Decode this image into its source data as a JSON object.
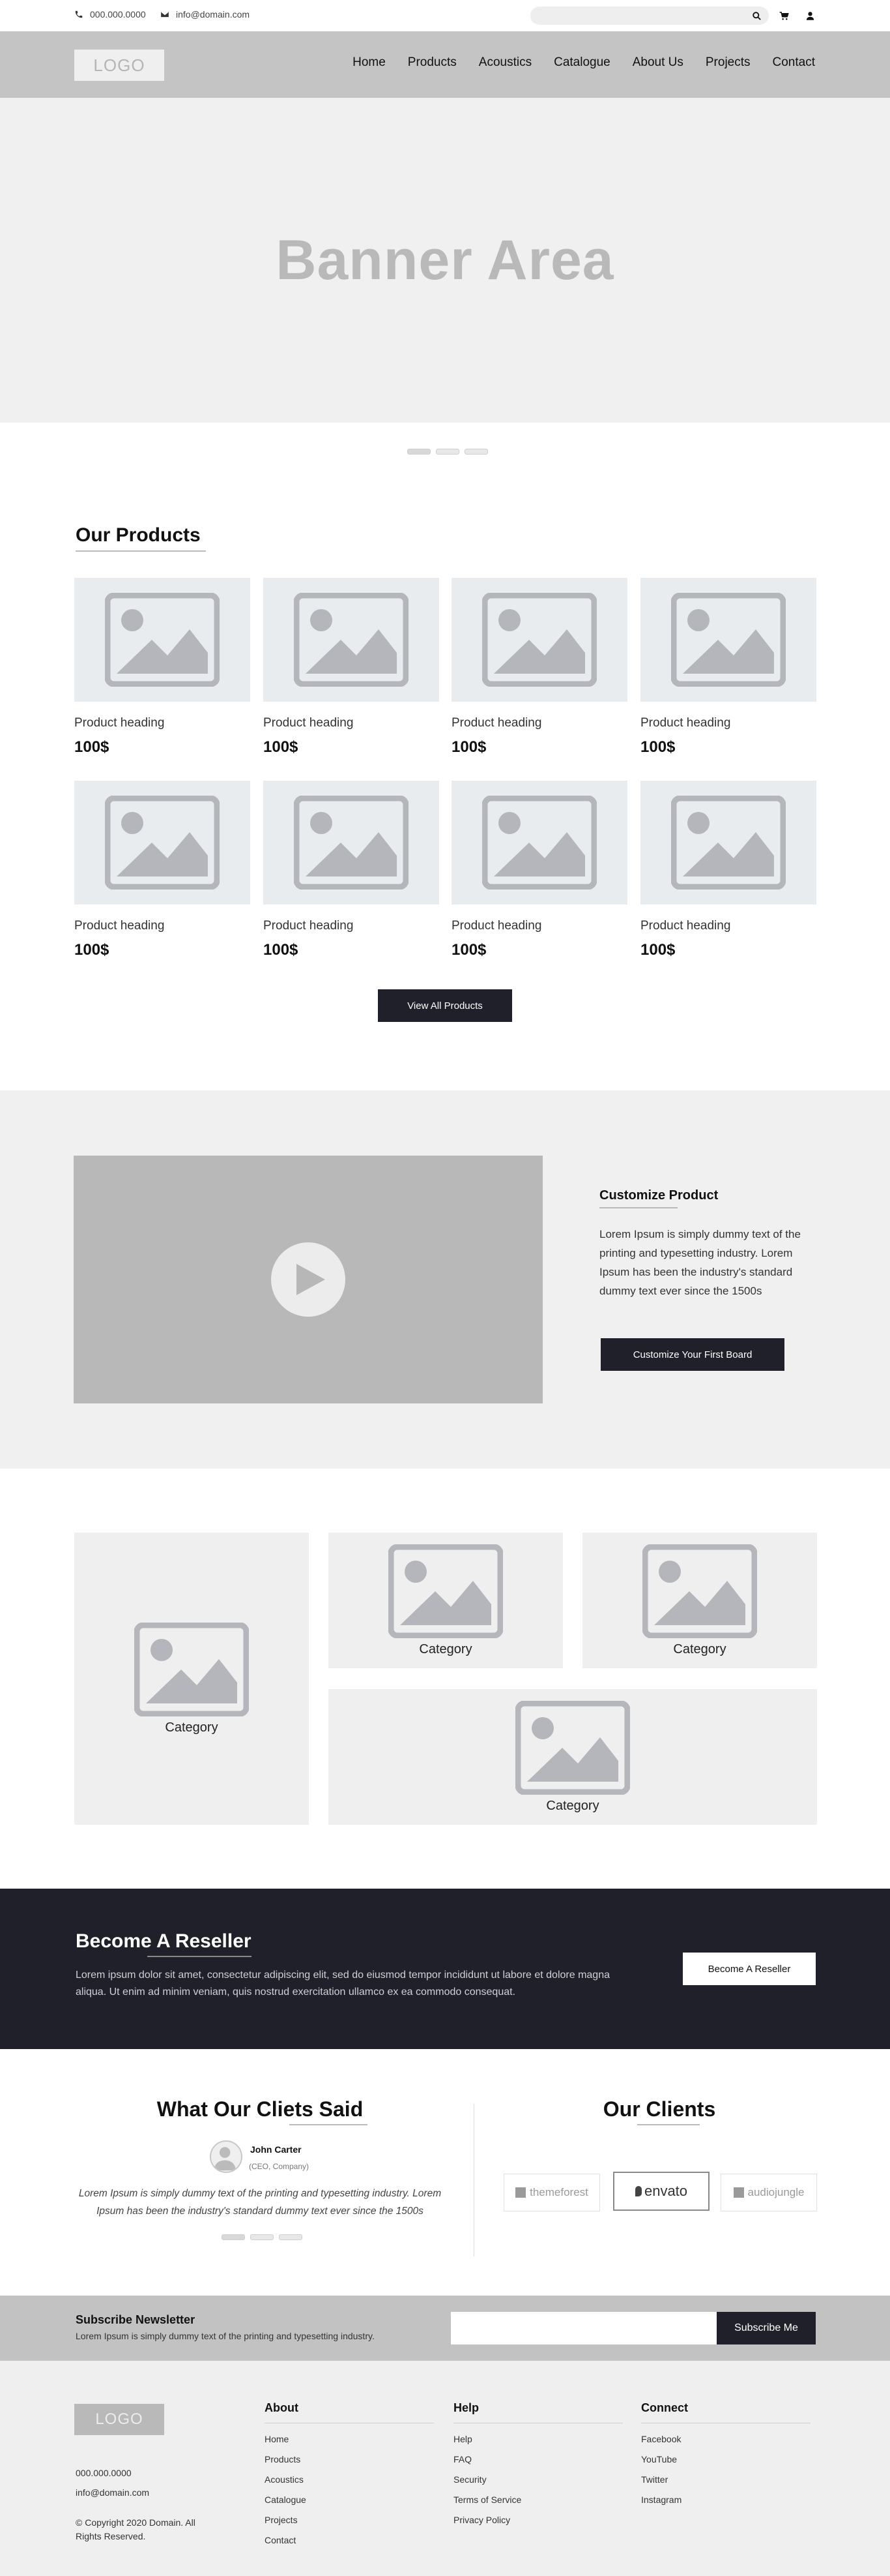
{
  "topbar": {
    "phone": "000.000.0000",
    "email": "info@domain.com",
    "search_placeholder": "",
    "icons": [
      "phone-icon",
      "mail-icon",
      "search-icon",
      "cart-icon",
      "user-icon"
    ]
  },
  "header": {
    "logo": "LOGO",
    "nav": [
      "Home",
      "Products",
      "Acoustics",
      "Catalogue",
      "About Us",
      "Projects",
      "Contact"
    ]
  },
  "banner": {
    "title": "Banner Area",
    "slides": 3,
    "active_slide": 1
  },
  "products": {
    "title": "Our Products",
    "items": [
      {
        "name": "Product  heading",
        "price": "100$"
      },
      {
        "name": "Product  heading",
        "price": "100$"
      },
      {
        "name": "Product  heading",
        "price": "100$"
      },
      {
        "name": "Product  heading",
        "price": "100$"
      },
      {
        "name": "Product  heading",
        "price": "100$"
      },
      {
        "name": "Product  heading",
        "price": "100$"
      },
      {
        "name": "Product  heading",
        "price": "100$"
      },
      {
        "name": "Product  heading",
        "price": "100$"
      }
    ],
    "view_all": "View All Products"
  },
  "customize": {
    "title": "Customize Product",
    "text": "Lorem Ipsum is simply dummy text of the printing and typesetting industry. Lorem Ipsum has been the industry's standard dummy text ever since the 1500s",
    "button": "Customize Your First Board"
  },
  "categories": [
    "Category",
    "Category",
    "Category",
    "Category"
  ],
  "reseller": {
    "title": "Become A Reseller",
    "text": "Lorem ipsum dolor sit amet, consectetur adipiscing elit, sed do eiusmod tempor incididunt ut labore et dolore magna aliqua. Ut enim ad minim veniam, quis nostrud exercitation ullamco ex ea commodo consequat.",
    "button": "Become A Reseller"
  },
  "testimonials": {
    "title": "What Our Cliets Said",
    "name": "John Carter",
    "role": "(CEO, Company)",
    "quote": "Lorem Ipsum is simply dummy text of the printing and typesetting industry. Lorem Ipsum has been the industry's standard dummy text ever since the 1500s"
  },
  "clients": {
    "title": "Our Clients",
    "logos": [
      "themeforest",
      "envato",
      "audiojungle"
    ]
  },
  "subscribe": {
    "title": "Subscribe Newsletter",
    "text": "Lorem Ipsum is simply dummy text of the printing and typesetting industry.",
    "placeholder": "",
    "button": "Subscribe Me"
  },
  "footer": {
    "logo": "LOGO",
    "phone": "000.000.0000",
    "email": "info@domain.com",
    "copyright": "© Copyright 2020 Domain. All Rights Reserved.",
    "about": {
      "title": "About",
      "links": [
        "Home",
        "Products",
        "Acoustics",
        "Catalogue",
        "Projects",
        "Contact"
      ]
    },
    "help": {
      "title": "Help",
      "links": [
        "Help",
        "FAQ",
        "Security",
        "Terms of Service",
        "Privacy Policy"
      ]
    },
    "connect": {
      "title": "Connect",
      "links": [
        "Facebook",
        "YouTube",
        "Twitter",
        "Instagram"
      ]
    }
  },
  "colors": {
    "dark": "#20202b",
    "header": "#c4c4c4",
    "light": "#f0f0f0",
    "placeholder": "#b5b6bb"
  }
}
